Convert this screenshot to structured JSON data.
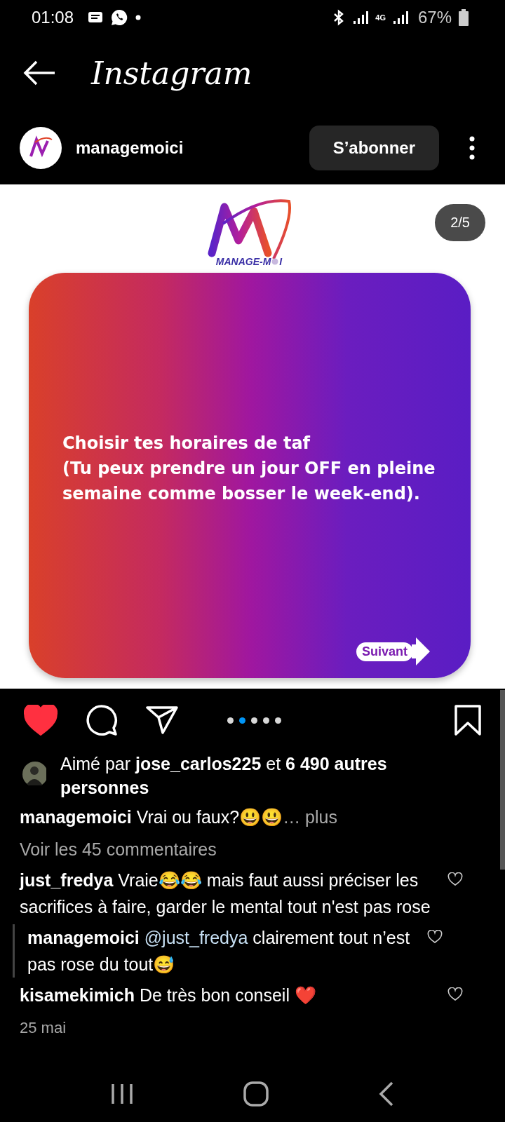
{
  "status_bar": {
    "time": "01:08",
    "network": "4G",
    "battery": "67%"
  },
  "header": {
    "title": "Instagram"
  },
  "post": {
    "username": "managemoici",
    "follow_label": "S’abonner",
    "page_indicator": "2/5",
    "slide": {
      "brand_start": "MANAGE-M",
      "brand_end": "I",
      "text": "Choisir tes horaires de taf\n(Tu peux prendre un jour OFF en pleine semaine comme bosser le week-end).",
      "next_label": "Suivant"
    },
    "liked": true,
    "saved": false,
    "dots": [
      {
        "selected": false
      },
      {
        "selected": true
      },
      {
        "selected": false
      },
      {
        "selected": false
      },
      {
        "selected": false
      }
    ],
    "likes_text": "Aimé par **jose_carlos225** et **6 490 autres personnes**",
    "caption": {
      "user": "managemoici",
      "text": "Vrai ou faux?😃😃",
      "more": "… plus"
    },
    "view_comments": "Voir les 45 commentaires",
    "comments": [
      {
        "user": "just_fredya",
        "text": "Vraie😂😂 mais faut aussi préciser les sacrifices à faire, garder le mental tout n'est pas rose",
        "liked": false,
        "reply": false
      },
      {
        "user": "managemoici",
        "mention": "@just_fredya",
        "text": "clairement tout n’est pas rose du tout😅",
        "liked": false,
        "reply": true
      },
      {
        "user": "kisamekimich",
        "text": "De très bon conseil ❤️",
        "liked": false,
        "reply": false
      }
    ],
    "date": "25 mai"
  }
}
